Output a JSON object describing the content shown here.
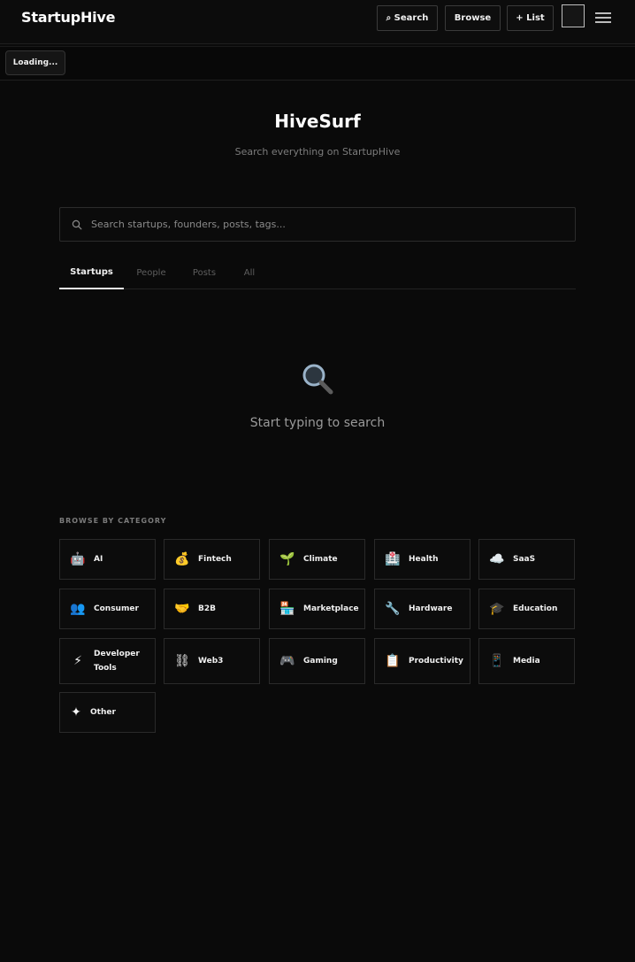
{
  "header": {
    "brand": "StartupHive",
    "search_label": "⌕ Search",
    "browse_label": "Browse",
    "list_label": "+ List"
  },
  "status": {
    "loading": "Loading..."
  },
  "hero": {
    "title": "HiveSurf",
    "subtitle": "Search everything on StartupHive"
  },
  "search": {
    "placeholder": "Search startups, founders, posts, tags..."
  },
  "tabs": [
    {
      "label": "Startups",
      "active": true
    },
    {
      "label": "People",
      "active": false
    },
    {
      "label": "Posts",
      "active": false
    },
    {
      "label": "All",
      "active": false
    }
  ],
  "empty_state": {
    "icon": "🔍",
    "text": "Start typing to search"
  },
  "categories": {
    "heading": "BROWSE BY CATEGORY",
    "items": [
      {
        "icon": "🤖",
        "label": "AI"
      },
      {
        "icon": "💰",
        "label": "Fintech"
      },
      {
        "icon": "🌱",
        "label": "Climate"
      },
      {
        "icon": "🏥",
        "label": "Health"
      },
      {
        "icon": "☁️",
        "label": "SaaS"
      },
      {
        "icon": "👥",
        "label": "Consumer"
      },
      {
        "icon": "🤝",
        "label": "B2B"
      },
      {
        "icon": "🏪",
        "label": "Marketplace"
      },
      {
        "icon": "🔧",
        "label": "Hardware"
      },
      {
        "icon": "🎓",
        "label": "Education"
      },
      {
        "icon": "⚡",
        "label": "Developer Tools"
      },
      {
        "icon": "⛓",
        "label": "Web3"
      },
      {
        "icon": "🎮",
        "label": "Gaming"
      },
      {
        "icon": "📋",
        "label": "Productivity"
      },
      {
        "icon": "📱",
        "label": "Media"
      },
      {
        "icon": "✦",
        "label": "Other"
      }
    ]
  },
  "colors": {
    "background": "#0a0a0a",
    "border": "#2a2a2a",
    "text": "#f0f0f0",
    "muted": "#7b7b7b"
  }
}
